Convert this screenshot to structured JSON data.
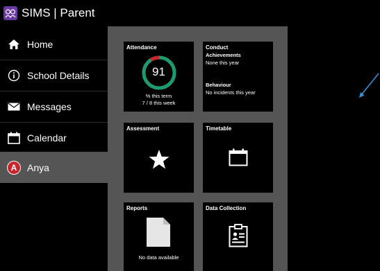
{
  "app": {
    "title": "SIMS | Parent"
  },
  "nav": [
    {
      "label": "Home",
      "icon": "home-icon"
    },
    {
      "label": "School Details",
      "icon": "info-icon"
    },
    {
      "label": "Messages",
      "icon": "envelope-icon"
    },
    {
      "label": "Calendar",
      "icon": "calendar-icon"
    },
    {
      "label": "Anya",
      "icon": "avatar-icon",
      "initial": "A",
      "active": true
    }
  ],
  "tiles": {
    "attendance": {
      "title": "Attendance",
      "percent": "91",
      "caption1": "% this term",
      "caption2": "7 / 8 this week",
      "ring_fraction": 0.91
    },
    "conduct": {
      "title": "Conduct",
      "achievements_title": "Achievements",
      "achievements_text": "None this year",
      "behaviour_title": "Behaviour",
      "behaviour_text": "No incidents this year"
    },
    "assessment": {
      "title": "Assessment"
    },
    "timetable": {
      "title": "Timetable"
    },
    "reports": {
      "title": "Reports",
      "caption": "No data available"
    },
    "data_collection": {
      "title": "Data Collection"
    }
  },
  "colors": {
    "accent_purple": "#6a3aa3",
    "ring_green": "#1e9a6f",
    "ring_red": "#c8252c",
    "active_nav": "#555555",
    "avatar_red": "#c8252c",
    "arrow_blue": "#3a8fd8"
  }
}
